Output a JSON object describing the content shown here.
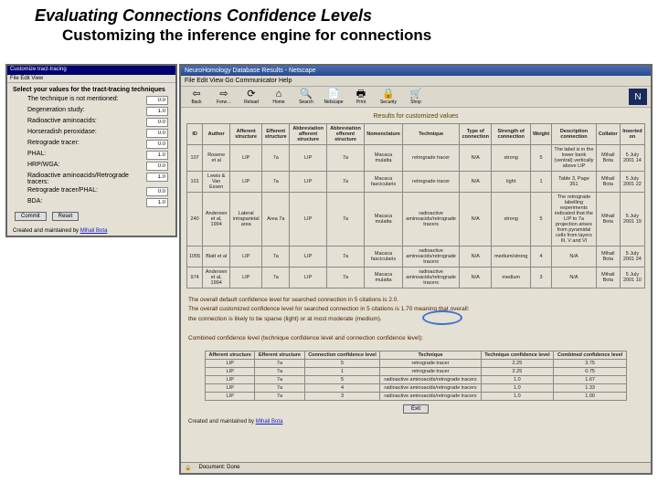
{
  "slide": {
    "title": "Evaluating Connections Confidence Levels",
    "subtitle": "Customizing the inference engine for connections"
  },
  "left": {
    "title": "Customize tract-tracing",
    "menu": "File  Edit  View",
    "heading": "Select your values for the tract-tracing techniques",
    "rows": [
      {
        "label": "The technique is not mentioned:",
        "value": "0.0"
      },
      {
        "label": "Degeneration study:",
        "value": "1.0"
      },
      {
        "label": "Radioactive aminoacids:",
        "value": "0.0"
      },
      {
        "label": "Horseradish peroxidase:",
        "value": "0.0"
      },
      {
        "label": "Retrograde tracer:",
        "value": "0.0"
      },
      {
        "label": "PHAL:",
        "value": "1.0"
      },
      {
        "label": "HRP/WGA:",
        "value": "0.0"
      },
      {
        "label": "Radioactive aminoacids/Retrograde tracers:",
        "value": "1.0"
      },
      {
        "label": "Retrograde tracer/PHAL:",
        "value": "0.0"
      },
      {
        "label": "BDA:",
        "value": "1.0"
      }
    ],
    "btn_commit": "Commit",
    "btn_reset": "Reset",
    "credit": "Created and maintained by ",
    "credit_name": "Mihail Bota"
  },
  "browser": {
    "title": "NeuroHomology Database Results - Netscape",
    "menu": "File   Edit   View   Go   Communicator   Help",
    "toolbar": [
      {
        "glyph": "⇦",
        "label": "Back",
        "name": "back-button"
      },
      {
        "glyph": "⇨",
        "label": "Forw…",
        "name": "forward-button"
      },
      {
        "glyph": "⟳",
        "label": "Reload",
        "name": "reload-button"
      },
      {
        "glyph": "⌂",
        "label": "Home",
        "name": "home-button"
      },
      {
        "glyph": "🔍",
        "label": "Search",
        "name": "search-button"
      },
      {
        "glyph": "📄",
        "label": "Netscape",
        "name": "netscape-button"
      },
      {
        "glyph": "🖶",
        "label": "Print",
        "name": "print-button"
      },
      {
        "glyph": "🔒",
        "label": "Security",
        "name": "security-button"
      },
      {
        "glyph": "🛒",
        "label": "Shop",
        "name": "shop-button"
      }
    ],
    "results_caption": "Results for customized values",
    "headers": [
      "ID",
      "Author",
      "Afferent structure",
      "Efferent structure",
      "Abbreviation afferent structure",
      "Abbreviation efferent structure",
      "Nomenclature",
      "Technique",
      "Type of connection",
      "Strength of connection",
      "Weight",
      "Description connection",
      "Collator",
      "Inserted on"
    ],
    "rows": [
      {
        "id": "107",
        "author": "Rosene et al",
        "aff": "LIP",
        "eff": "7a",
        "aaff": "LIP",
        "aeff": "7a",
        "nom": "Macaca mulatta",
        "tech": "retrograde tracer",
        "type": "N/A",
        "str": "strong",
        "w": "5",
        "desc": "The label is in the lower bank (ventral) vertically above LIP",
        "coll": "Mihail Bota",
        "date": "5 July 2001 14"
      },
      {
        "id": "101",
        "author": "Lewis & Van Essen",
        "aff": "LIP",
        "eff": "7a",
        "aaff": "LIP",
        "aeff": "7a",
        "nom": "Macaca fascicularis",
        "tech": "retrograde tracer",
        "type": "N/A",
        "str": "light",
        "w": "1",
        "desc": "Table 3, Page 351",
        "coll": "Mihail Bota",
        "date": "5 July 2001 22"
      },
      {
        "id": "240",
        "author": "Andersen et al, 1994",
        "aff": "Lateral intraparietal area",
        "eff": "Area 7a",
        "aaff": "LIP",
        "aeff": "7a",
        "nom": "Macaca mulatta",
        "tech": "radioactive aminoacids/retrograde tracers",
        "type": "N/A",
        "str": "strong",
        "w": "5",
        "desc": "The retrograde labelling experiments indicated that the LIP to 7a projection arises from pyramidal cells from layers III, V and VI",
        "coll": "Mihail Bota",
        "date": "5 July 2001 19"
      },
      {
        "id": "1055",
        "author": "Blatt et al",
        "aff": "LIP",
        "eff": "7a",
        "aaff": "LIP",
        "aeff": "7a",
        "nom": "Macaca fascicularis",
        "tech": "radioactive aminoacids/retrograde tracers",
        "type": "N/A",
        "str": "medium/strong",
        "w": "4",
        "desc": "N/A",
        "coll": "Mihail Bota",
        "date": "5 July 2001 24"
      },
      {
        "id": "974",
        "author": "Andersen et al, 1994",
        "aff": "LIP",
        "eff": "7a",
        "aaff": "LIP",
        "aeff": "7a",
        "nom": "Macaca mulatta",
        "tech": "radioactive aminoacids/retrograde tracers",
        "type": "N/A",
        "str": "medium",
        "w": "3",
        "desc": "N/A",
        "coll": "Mihail Bota",
        "date": "5 July 2001 10"
      }
    ],
    "summary": {
      "line1": "The overall default confidence level for searched connection in 5 citations is 2.0.",
      "line2a": "The overall customized confidence level for searched connection in 5 citations is ",
      "line2b": "1.70 meaning that overall:",
      "line3": "the connection is likely to be sparse (light) or at most moderate (medium).",
      "line4": "Combined confidence level (technique confidence level and connection confidence level):"
    },
    "combo_headers": [
      "Afferent structure",
      "Efferent structure",
      "Connection confidence level",
      "Technique",
      "Technique confidence level",
      "Combined confidence level"
    ],
    "combo_rows": [
      {
        "a": "LIP",
        "e": "7a",
        "c": "5",
        "t": "retrograde tracer",
        "tc": "2.25",
        "cc": "3.75"
      },
      {
        "a": "LIP",
        "e": "7a",
        "c": "1",
        "t": "retrograde tracer",
        "tc": "2.25",
        "cc": "0.75"
      },
      {
        "a": "LIP",
        "e": "7a",
        "c": "5",
        "t": "radioactive aminoacids/retrograde tracers",
        "tc": "1.0",
        "cc": "1.67"
      },
      {
        "a": "LIP",
        "e": "7a",
        "c": "4",
        "t": "radioactive aminoacids/retrograde tracers",
        "tc": "1.0",
        "cc": "1.33"
      },
      {
        "a": "LIP",
        "e": "7a",
        "c": "3",
        "t": "radioactive aminoacids/retrograde tracers",
        "tc": "1.0",
        "cc": "1.00"
      }
    ],
    "exit": "Exit",
    "credit": "Created and maintained by ",
    "credit_name": "Mihail Bota",
    "status": "Document: Done"
  }
}
